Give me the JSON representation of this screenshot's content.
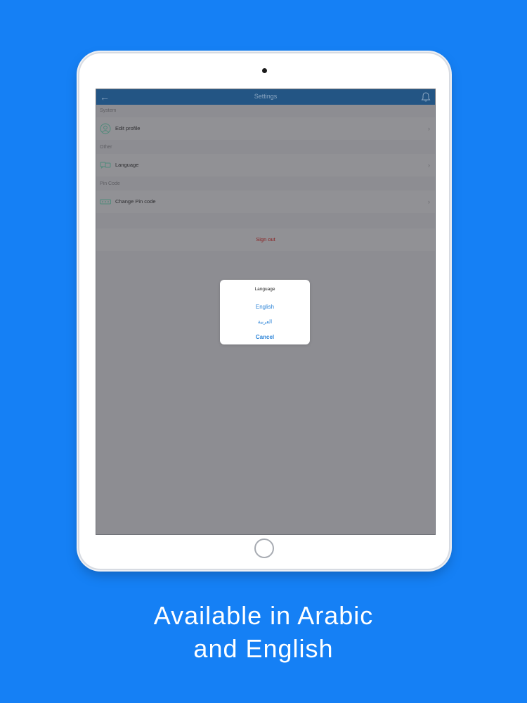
{
  "device": {
    "navbar": {
      "title": "Settings",
      "back_icon": "arrow-left-icon",
      "bell_icon": "bell-icon"
    },
    "sections": [
      {
        "header": "System",
        "row": {
          "label": "Edit profile",
          "icon": "user-circle-icon"
        }
      },
      {
        "header": "Other",
        "row": {
          "label": "Language",
          "icon": "language-icon"
        }
      },
      {
        "header": "Pin Code",
        "row": {
          "label": "Change Pin code",
          "icon": "pin-code-icon"
        }
      }
    ],
    "sign_out": "Sign out",
    "dialog": {
      "title": "Language",
      "options": [
        "English",
        "العربية"
      ],
      "cancel": "Cancel"
    }
  },
  "caption": {
    "line1": "Available in Arabic",
    "line2": "and English"
  },
  "colors": {
    "background": "#1580f5",
    "navbar": "#235584",
    "overlay_screen": "#8d8d92",
    "dialog_link": "#2e85d8",
    "sign_out": "#8a1f20"
  }
}
